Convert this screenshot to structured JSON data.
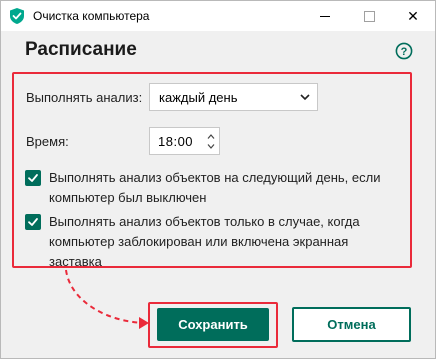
{
  "window": {
    "title": "Очистка компьютера",
    "icon": "kaspersky-shield-icon",
    "controls": [
      "minimize-icon",
      "maximize-icon",
      "close-icon"
    ],
    "close_glyph": "✕"
  },
  "page": {
    "title": "Расписание",
    "help_icon": "help-circle-icon",
    "help_glyph": "?"
  },
  "form": {
    "run_scan_label": "Выполнять анализ:",
    "run_scan_value": "каждый день",
    "time_label": "Время:",
    "time_value": "18:00",
    "checkbox_next_day": {
      "label": "Выполнять анализ объектов на следующий день, если компьютер был выключен",
      "checked": true
    },
    "checkbox_locked": {
      "label": "Выполнять анализ объектов только в случае, когда компьютер заблокирован или включена экранная заставка",
      "checked": true
    }
  },
  "buttons": {
    "save_label": "Сохранить",
    "cancel_label": "Отмена"
  },
  "colors": {
    "accent": "#006d5b",
    "highlight": "#ea2a3a",
    "background": "#f0f0f0"
  }
}
